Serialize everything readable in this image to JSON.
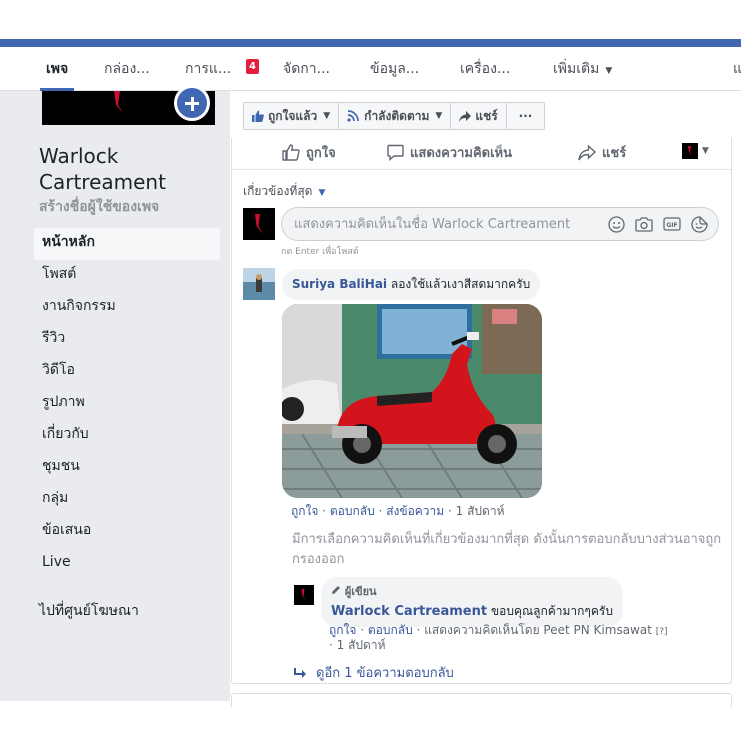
{
  "tabs": [
    {
      "label": "เพจ"
    },
    {
      "label": "กล่อง..."
    },
    {
      "label": "การแ..."
    },
    {
      "label": "จัดกา..."
    },
    {
      "label": "ข้อมูล..."
    },
    {
      "label": "เครื่อง..."
    },
    {
      "label": "เพิ่มเติม"
    },
    {
      "label": "แ"
    }
  ],
  "tab_badge": "4",
  "page": {
    "name": "Warlock Cartreament",
    "username_prompt": "สร้างชื่อผู้ใช้ของเพจ"
  },
  "nav": [
    {
      "label": "หน้าหลัก"
    },
    {
      "label": "โพสต์"
    },
    {
      "label": "งานกิจกรรม"
    },
    {
      "label": "รีวิว"
    },
    {
      "label": "วิดีโอ"
    },
    {
      "label": "รูปภาพ"
    },
    {
      "label": "เกี่ยวกับ"
    },
    {
      "label": "ชุมชน"
    },
    {
      "label": "กลุ่ม"
    },
    {
      "label": "ข้อเสนอ"
    },
    {
      "label": "Live"
    }
  ],
  "ads_link": "ไปที่ศูนย์โฆษณา",
  "actions": {
    "liked": "ถูกใจแล้ว",
    "following": "กำลังติดตาม",
    "share": "แชร์",
    "more": "···"
  },
  "post_reactions": {
    "like": "ถูกใจ",
    "comment": "แสดงความคิดเห็น",
    "share": "แชร์"
  },
  "comments": {
    "sort_label": "เกี่ยวข้องที่สุด",
    "input_placeholder": "แสดงความคิดเห็นในชื่อ Warlock Cartreament",
    "enter_hint": "กด Enter เพื่อโพสต์",
    "first": {
      "author": "Suriya BaliHai",
      "text": "ลองใช้แล้วเงาสีสดมากครับ",
      "like": "ถูกใจ",
      "reply": "ตอบกลับ",
      "message": "ส่งข้อความ",
      "time": "1 สัปดาห์"
    },
    "filtered_notice": "มีการเลือกความคิดเห็นที่เกี่ยวข้องมากที่สุด ดังนั้นการตอบกลับบางส่วนอาจถูกกรองออก",
    "reply": {
      "tag": "ผู้เขียน",
      "author": "Warlock Cartreament",
      "text": "ขอบคุณลูกค้ามากๆครับ",
      "like": "ถูกใจ",
      "reply": "ตอบกลับ",
      "commented_by": "แสดงความคิดเห็นโดย Peet PN Kimsawat",
      "help": "[?]",
      "time": "1 สัปดาห์"
    },
    "more_replies": "ดูอีก 1 ข้อความตอบกลับ"
  },
  "colors": {
    "brand": "#4267b2",
    "link": "#385898",
    "badge": "#e41e3f",
    "background": "#e9ebee"
  }
}
